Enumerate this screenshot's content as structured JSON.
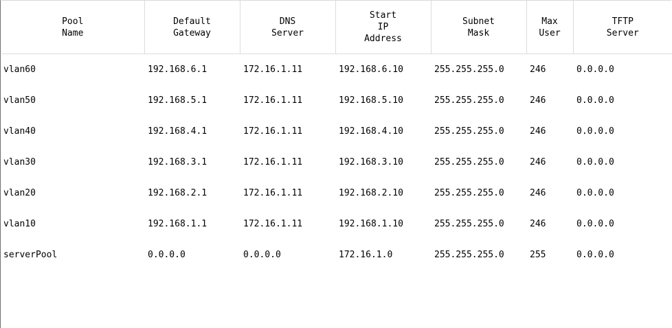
{
  "headers": [
    "Pool\nName",
    "Default\nGateway",
    "DNS\nServer",
    "Start\nIP\nAddress",
    "Subnet\nMask",
    "Max\nUser",
    "TFTP\nServer"
  ],
  "rows": [
    [
      "vlan60",
      "192.168.6.1",
      "172.16.1.11",
      "192.168.6.10",
      "255.255.255.0",
      "246",
      "0.0.0.0"
    ],
    [
      "vlan50",
      "192.168.5.1",
      "172.16.1.11",
      "192.168.5.10",
      "255.255.255.0",
      "246",
      "0.0.0.0"
    ],
    [
      "vlan40",
      "192.168.4.1",
      "172.16.1.11",
      "192.168.4.10",
      "255.255.255.0",
      "246",
      "0.0.0.0"
    ],
    [
      "vlan30",
      "192.168.3.1",
      "172.16.1.11",
      "192.168.3.10",
      "255.255.255.0",
      "246",
      "0.0.0.0"
    ],
    [
      "vlan20",
      "192.168.2.1",
      "172.16.1.11",
      "192.168.2.10",
      "255.255.255.0",
      "246",
      "0.0.0.0"
    ],
    [
      "vlan10",
      "192.168.1.1",
      "172.16.1.11",
      "192.168.1.10",
      "255.255.255.0",
      "246",
      "0.0.0.0"
    ],
    [
      "serverPool",
      "0.0.0.0",
      "0.0.0.0",
      "172.16.1.0",
      "255.255.255.0",
      "255",
      "0.0.0.0"
    ]
  ]
}
